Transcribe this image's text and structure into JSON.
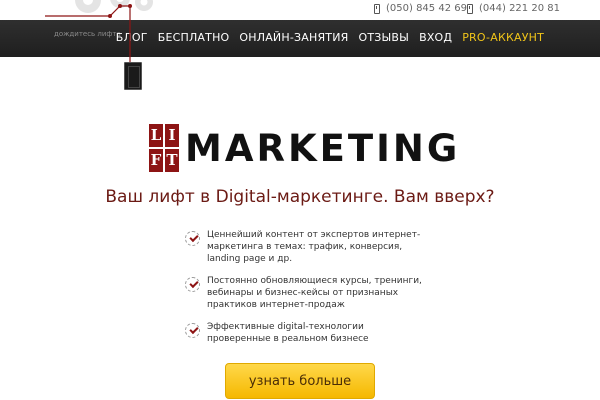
{
  "header": {
    "wait_text": "дождитесь лифта",
    "phones": [
      {
        "number": "(050) 845 42 69",
        "icon": "mobile-phone-icon"
      },
      {
        "number": "(044) 221 20 81",
        "icon": "mobile-phone-icon"
      }
    ]
  },
  "nav": {
    "items": [
      {
        "label": "БЛОГ"
      },
      {
        "label": "БЕСПЛАТНО"
      },
      {
        "label": "ОНЛАЙН-ЗАНЯТИЯ"
      },
      {
        "label": "ОТЗЫВЫ"
      },
      {
        "label": "ВХОД"
      },
      {
        "label": "PRO-АККАУНТ"
      }
    ]
  },
  "logo": {
    "letters": [
      "L",
      "I",
      "F",
      "T"
    ],
    "word": "MARKETING"
  },
  "hero": {
    "headline": "Ваш лифт в Digital-маркетинге. Вам вверх?"
  },
  "features": [
    {
      "text": "Ценнейший контент от экспертов интернет-маркетинга в темах: трафик, конверсия, landing page и др."
    },
    {
      "text": "Постоянно обновляющиеся курсы, тренинги, вебинары и бизнес-кейсы от признаных практиков интернет-продаж"
    },
    {
      "text": "Эффективные digital-технологии проверенные в реальном бизнесе"
    }
  ],
  "cta": {
    "label": "узнать больше"
  },
  "colors": {
    "brand_red": "#8d1414",
    "accent_yellow": "#f5b800",
    "nav_bg": "#262626",
    "pro_text": "#f0c419"
  }
}
